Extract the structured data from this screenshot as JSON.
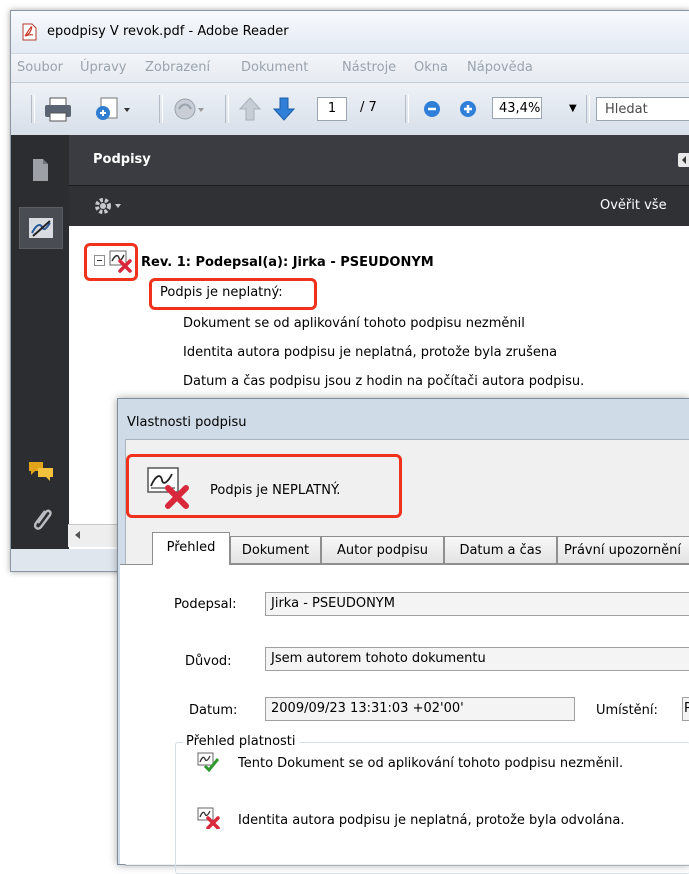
{
  "window": {
    "title": "epodpisy V revok.pdf - Adobe Reader",
    "menu": [
      "Soubor",
      "Úpravy",
      "Zobrazení",
      "Dokument",
      "Nástroje",
      "Okna",
      "Nápověda"
    ]
  },
  "toolbar": {
    "page_current": "1",
    "page_total": "/ 7",
    "zoom": "43,4%",
    "search_placeholder": "Hledat"
  },
  "signatures_panel": {
    "title": "Podpisy",
    "verify_all": "Ověřit vše",
    "revision": "Rev. 1: Podepsal(a): Jirka - PSEUDONYM",
    "status": "Podpis je neplatný:",
    "details": [
      "Dokument se od aplikování tohoto podpisu nezměnil",
      "Identita autora podpisu je neplatná, protože byla zrušena",
      "Datum a čas podpisu jsou z hodin na počítači autora podpisu."
    ]
  },
  "dialog": {
    "title": "Vlastnosti podpisu",
    "status": "Podpis je NEPLATNÝ.",
    "tabs": [
      "Přehled",
      "Dokument",
      "Autor podpisu",
      "Datum a čas",
      "Právní upozornění"
    ],
    "fields": {
      "signed_by_label": "Podepsal:",
      "signed_by_value": "Jirka - PSEUDONYM",
      "reason_label": "Důvod:",
      "reason_value": "Jsem autorem tohoto dokumentu",
      "date_label": "Datum:",
      "date_value": "2009/09/23 13:31:03 +02'00'",
      "location_label": "Umístění:",
      "location_value": "P"
    },
    "validity": {
      "legend": "Přehled platnosti",
      "items": [
        "Tento Dokument se od aplikování tohoto podpisu nezměnil.",
        "Identita autora podpisu je neplatná, protože byla odvolána."
      ]
    }
  },
  "colors": {
    "highlight_red": "#f0311c",
    "panel_dark": "#2b2d31"
  }
}
